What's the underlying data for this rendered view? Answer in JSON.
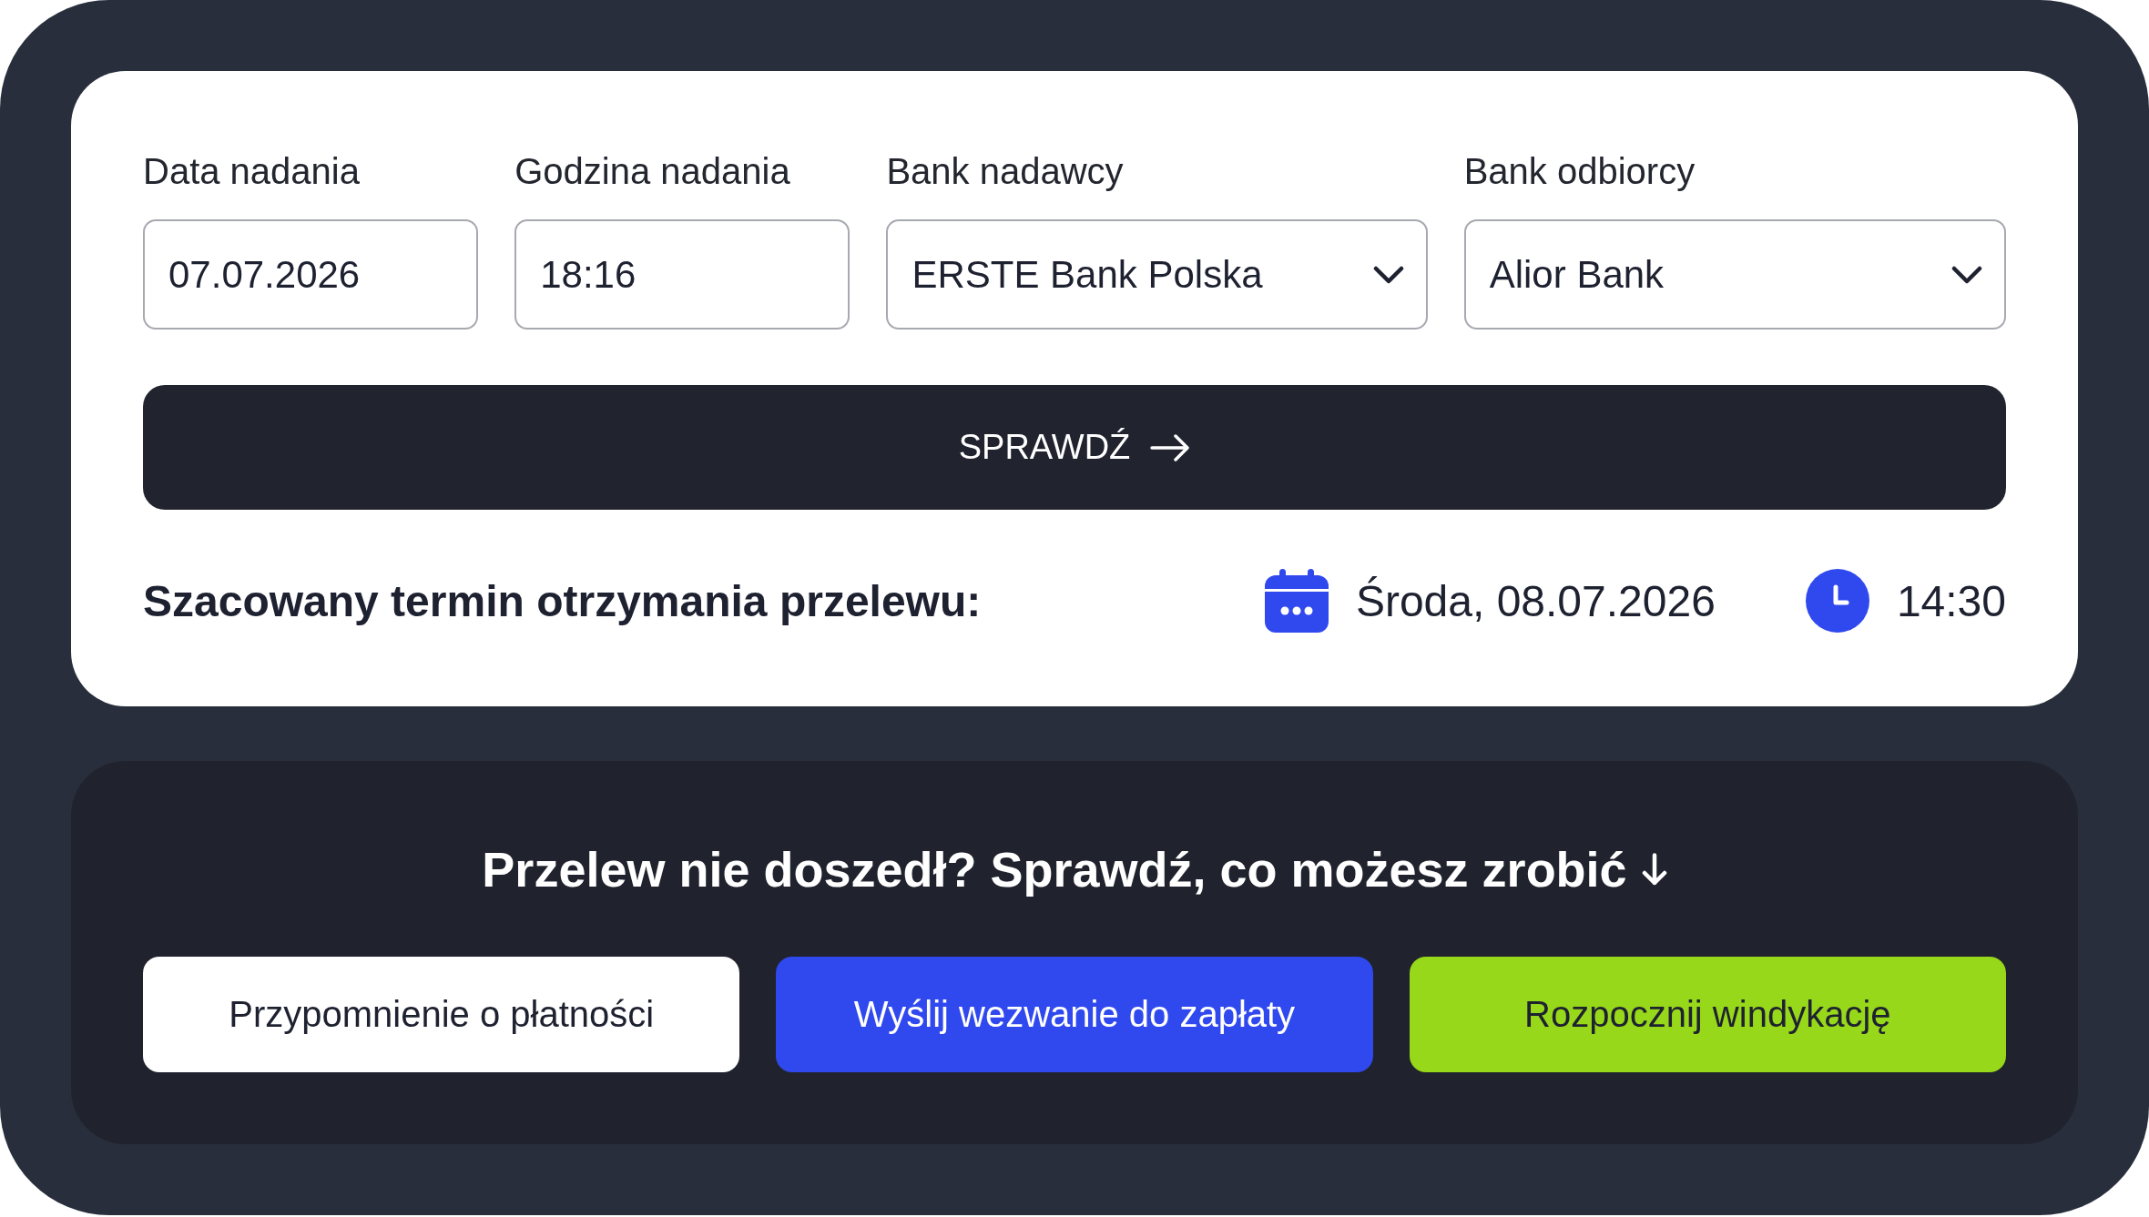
{
  "form": {
    "fields": [
      {
        "kind": "input",
        "label": "Data nadania",
        "value": "07.07.2026"
      },
      {
        "kind": "input",
        "label": "Godzina nadania",
        "value": "18:16"
      },
      {
        "kind": "select",
        "label": "Bank nadawcy",
        "value": "ERSTE Bank Polska"
      },
      {
        "kind": "select",
        "label": "Bank odbiorcy",
        "value": "Alior Bank"
      }
    ],
    "submit_button": {
      "label": "SPRAWDŹ"
    }
  },
  "result": {
    "label": "Szacowany termin otrzymania przelewu:",
    "date": "Środa, 08.07.2026",
    "time": "14:30"
  },
  "help": {
    "heading": "Przelew nie doszedł? Sprawdź, co możesz zrobić",
    "actions": [
      {
        "label": "Przypomnienie o płatności",
        "color": "#ffffff"
      },
      {
        "label": "Wyślij wezwanie do zapłaty",
        "color": "#3049ee"
      },
      {
        "label": "Rozpocznij windykację",
        "color": "#98d81a"
      }
    ]
  }
}
